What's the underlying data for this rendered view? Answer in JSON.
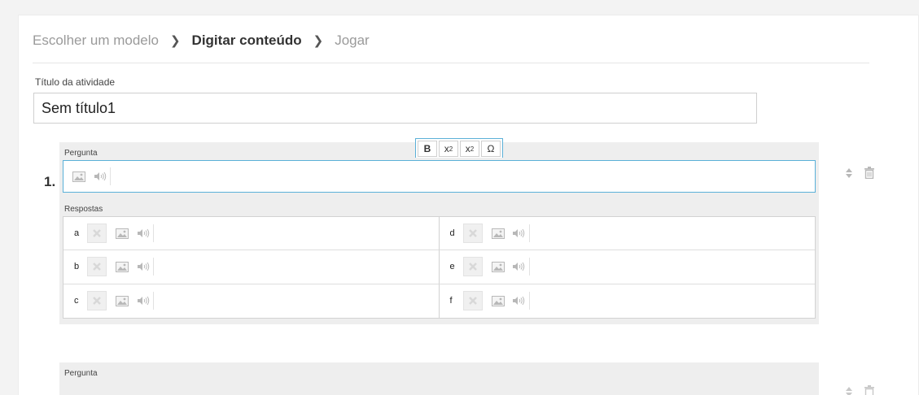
{
  "breadcrumb": {
    "step1": "Escolher um modelo",
    "step2": "Digitar conteúdo",
    "step3": "Jogar",
    "separator": "❯"
  },
  "activity": {
    "title_label": "Título da atividade",
    "title_value": "Sem título1"
  },
  "toolbar": {
    "bold": "B",
    "superscript_base": "x",
    "superscript_exp": "2",
    "subscript_base": "x",
    "subscript_sub": "2",
    "special_char": "Ω"
  },
  "questions": [
    {
      "number": "1.",
      "question_label": "Pergunta",
      "answers_label": "Respostas",
      "answers": [
        {
          "letter": "a"
        },
        {
          "letter": "d"
        },
        {
          "letter": "b"
        },
        {
          "letter": "e"
        },
        {
          "letter": "c"
        },
        {
          "letter": "f"
        }
      ]
    },
    {
      "question_label": "Pergunta"
    }
  ],
  "icons": {
    "image": "image-icon",
    "sound": "speaker-icon",
    "remove": "close-x-icon",
    "reorder": "sort-arrows-icon",
    "delete": "trash-icon"
  },
  "colors": {
    "focus_border": "#5ab0d8",
    "block_bg": "#eeeeee",
    "icon_gray": "#b8b8b8"
  }
}
